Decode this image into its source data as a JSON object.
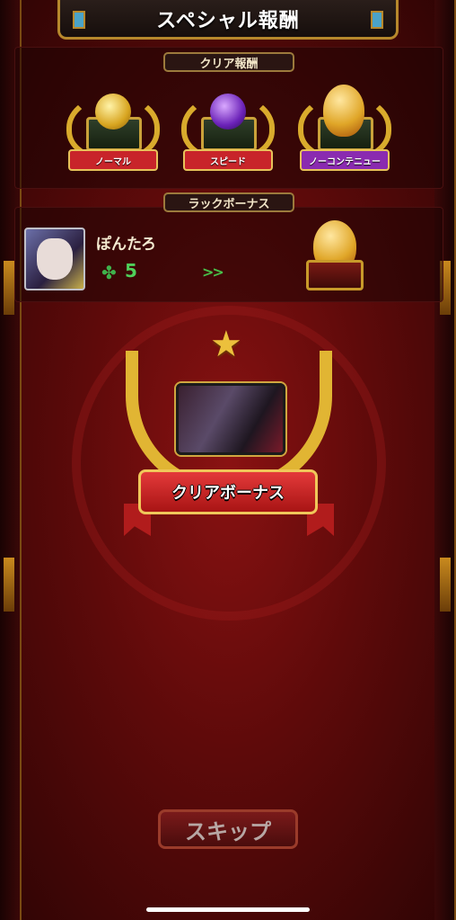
{
  "header": {
    "title": "スペシャル報酬"
  },
  "clear_rewards": {
    "section_label": "クリア報酬",
    "items": [
      {
        "label": "ノーマル",
        "ribbon_color": "#c8242a",
        "item_icon": "gold-coin-icon"
      },
      {
        "label": "スピード",
        "ribbon_color": "#c8242a",
        "item_icon": "purple-orb-icon"
      },
      {
        "label": "ノーコンテニュー",
        "ribbon_color": "#8a2bb0",
        "item_icon": "golden-egg-icon"
      }
    ]
  },
  "luck_bonus": {
    "section_label": "ラックボーナス",
    "player_name": "ぽんたろ",
    "luck_value": "5",
    "arrow_text": ">>",
    "reward_icon": "golden-egg-icon"
  },
  "clear_bonus": {
    "label": "クリアボーナス"
  },
  "footer": {
    "skip_label": "スキップ"
  },
  "colors": {
    "background": "#6b0c0c",
    "gold": "#d9ab2c",
    "luck_green": "#4fd05a"
  }
}
